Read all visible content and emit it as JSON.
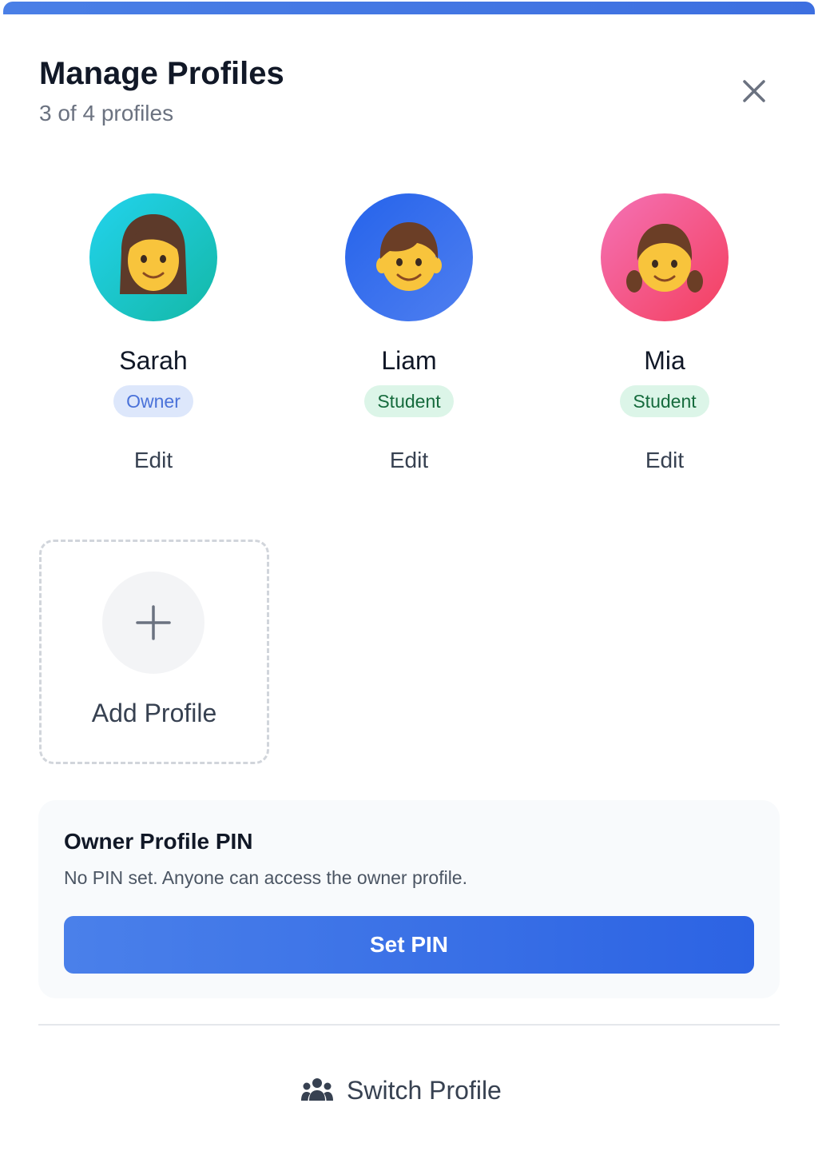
{
  "header": {
    "title": "Manage Profiles",
    "subtitle": "3 of 4 profiles"
  },
  "profiles": [
    {
      "name": "Sarah",
      "role": "Owner",
      "edit_label": "Edit",
      "avatar_icon": "woman-face-icon",
      "avatar_colors": [
        "#22d3ee",
        "#14b8a6"
      ]
    },
    {
      "name": "Liam",
      "role": "Student",
      "edit_label": "Edit",
      "avatar_icon": "boy-face-icon",
      "avatar_colors": [
        "#2563eb",
        "#4f7ff0"
      ]
    },
    {
      "name": "Mia",
      "role": "Student",
      "edit_label": "Edit",
      "avatar_icon": "girl-face-icon",
      "avatar_colors": [
        "#f472b6",
        "#f43f5e"
      ]
    }
  ],
  "add_profile": {
    "label": "Add Profile",
    "icon": "plus-icon"
  },
  "pin": {
    "title": "Owner Profile PIN",
    "description": "No PIN set. Anyone can access the owner profile.",
    "button_label": "Set PIN"
  },
  "footer": {
    "switch_label": "Switch Profile",
    "switch_icon": "users-icon"
  },
  "colors": {
    "accent": "#3d6fe0",
    "owner_badge_bg": "#dde7fb",
    "student_badge_bg": "#dcf5e8"
  }
}
